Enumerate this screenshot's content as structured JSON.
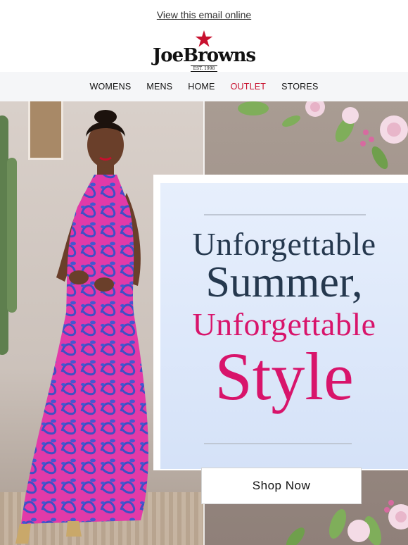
{
  "header": {
    "view_online_label": "View this email online",
    "brand_name": "JoeBrowns",
    "brand_tagline": "EST. 1998"
  },
  "nav": {
    "items": [
      {
        "label": "WOMENS"
      },
      {
        "label": "MENS"
      },
      {
        "label": "HOME"
      },
      {
        "label": "OUTLET",
        "highlight": true
      },
      {
        "label": "STORES"
      }
    ]
  },
  "hero": {
    "headline_line1": "Unforgettable",
    "headline_line2": "Summer,",
    "headline_line3": "Unforgettable",
    "headline_line4": "Style",
    "cta_label": "Shop Now"
  },
  "colors": {
    "brand_red": "#c8102e",
    "navy": "#25384e",
    "magenta": "#d8146b",
    "nav_bg": "#f5f6f8",
    "panel_bg": "#dbe6f9"
  },
  "icons": {
    "logo_star": "red-star-icon"
  }
}
